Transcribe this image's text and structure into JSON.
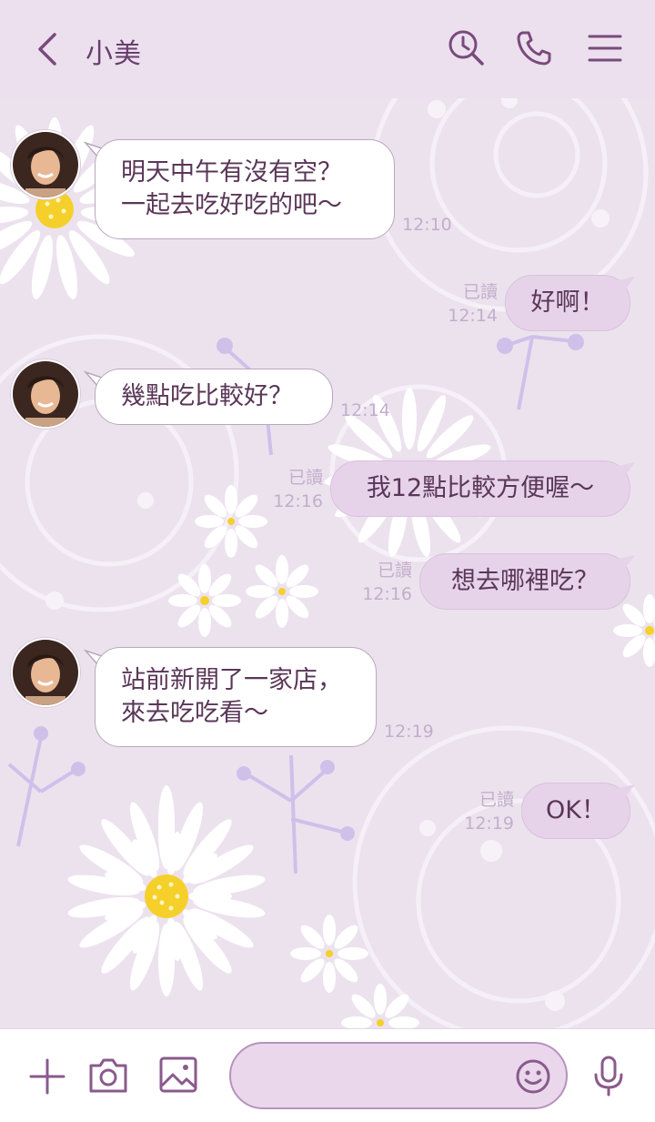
{
  "header": {
    "title": "小美",
    "back_icon": "chevron-left-icon",
    "search_icon": "search-icon",
    "call_icon": "phone-icon",
    "menu_icon": "menu-icon"
  },
  "messages": [
    {
      "side": "in",
      "lines": [
        "明天中午有沒有空？",
        "一起去吃好吃的吧～"
      ],
      "time": "12:10"
    },
    {
      "side": "out",
      "text": "好啊！",
      "read": "已讀",
      "time": "12:14"
    },
    {
      "side": "in",
      "lines": [
        "幾點吃比較好？"
      ],
      "time": "12:14"
    },
    {
      "side": "out",
      "text": "我12點比較方便喔～",
      "read": "已讀",
      "time": "12:16"
    },
    {
      "side": "out",
      "text": "想去哪裡吃？",
      "read": "已讀",
      "time": "12:16"
    },
    {
      "side": "in",
      "lines": [
        "站前新開了一家店，",
        "來去吃吃看～"
      ],
      "time": "12:19"
    },
    {
      "side": "out",
      "text": "OK！",
      "read": "已讀",
      "time": "12:19"
    }
  ],
  "input": {
    "placeholder": "",
    "value": ""
  },
  "toolbar": {
    "plus_icon": "plus-icon",
    "camera_icon": "camera-icon",
    "image_icon": "image-icon",
    "emoji_icon": "emoji-icon",
    "mic_icon": "mic-icon"
  },
  "colors": {
    "accent": "#8a5a8c",
    "header_bg": "#ece0ef",
    "chat_bg": "#ece2ee",
    "out_bubble": "#e6d3e9"
  }
}
